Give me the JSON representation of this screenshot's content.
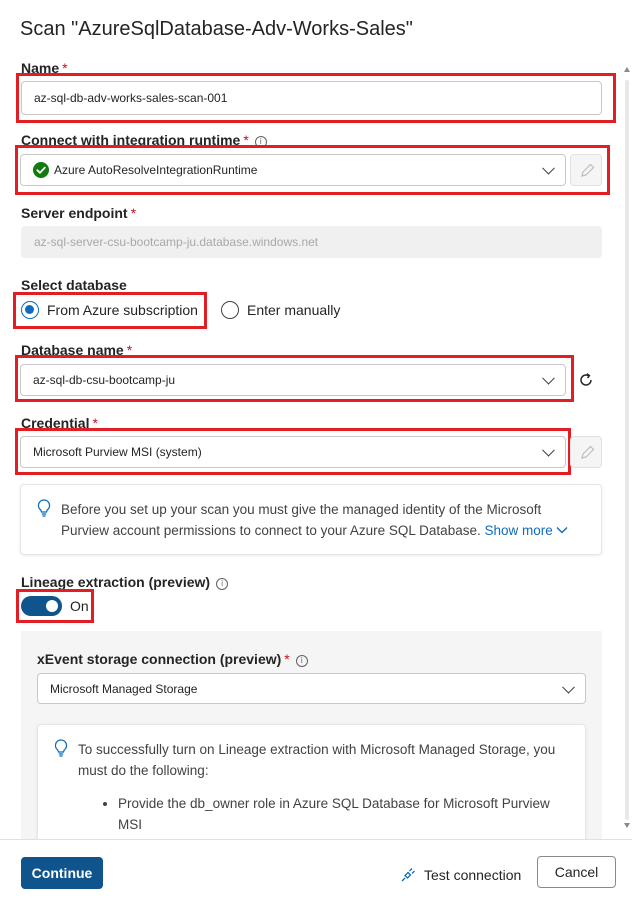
{
  "title": "Scan \"AzureSqlDatabase-Adv-Works-Sales\"",
  "name_field": {
    "label": "Name",
    "required": "*",
    "value": "az-sql-db-adv-works-sales-scan-001"
  },
  "runtime_field": {
    "label": "Connect with integration runtime",
    "required": "*",
    "value": "Azure AutoResolveIntegrationRuntime",
    "status_color": "#107c10"
  },
  "server_field": {
    "label": "Server endpoint",
    "required": "*",
    "value": "az-sql-server-csu-bootcamp-ju.database.windows.net"
  },
  "select_database": {
    "label": "Select database",
    "options": [
      "From Azure subscription",
      "Enter manually"
    ],
    "selected": "From Azure subscription"
  },
  "database_field": {
    "label": "Database name",
    "required": "*",
    "value": "az-sql-db-csu-bootcamp-ju"
  },
  "credential_field": {
    "label": "Credential",
    "required": "*",
    "value": "Microsoft Purview MSI (system)"
  },
  "info_note": {
    "text": "Before you set up your scan you must give the managed identity of the Microsoft Purview account permissions to connect to your Azure SQL Database.",
    "link": "Show more"
  },
  "lineage": {
    "label": "Lineage extraction (preview)",
    "toggle_state": "On"
  },
  "xevent": {
    "label": "xEvent storage connection (preview)",
    "required": "*",
    "value": "Microsoft Managed Storage"
  },
  "lineage_note": {
    "text": "To successfully turn on Lineage extraction with Microsoft Managed Storage, you must do the following:",
    "bullets": [
      "Provide the db_owner role in Azure SQL Database for Microsoft Purview MSI"
    ]
  },
  "footer": {
    "continue": "Continue",
    "test_connection": "Test connection",
    "cancel": "Cancel"
  },
  "colors": {
    "accent": "#0f548c",
    "highlight": "#e01e24",
    "link": "#0f6cbd"
  }
}
